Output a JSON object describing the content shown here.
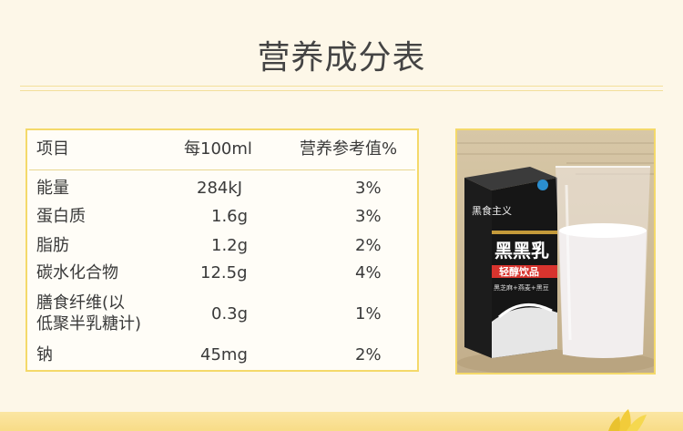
{
  "title": "营养成分表",
  "table": {
    "headers": [
      "项目",
      "每100ml",
      "营养参考值%"
    ],
    "rows": [
      {
        "item": "能量",
        "per100": "284kJ",
        "nrv": "3%"
      },
      {
        "item": "蛋白质",
        "per100": "1.6g",
        "nrv": "3%"
      },
      {
        "item": "脂肪",
        "per100": "1.2g",
        "nrv": "2%"
      },
      {
        "item": "碳水化合物",
        "per100": "12.5g",
        "nrv": "4%"
      },
      {
        "item_line1": "膳食纤维(以",
        "item_line2": "低聚半乳糖计)",
        "per100": "0.3g",
        "nrv": "1%"
      },
      {
        "item": "钠",
        "per100": "45mg",
        "nrv": "2%"
      }
    ]
  },
  "product": {
    "brand": "黑食主义",
    "name": "黑黑乳",
    "badge": "轻醇饮品",
    "tagline": "黑芝麻+燕麦+黑豆"
  }
}
